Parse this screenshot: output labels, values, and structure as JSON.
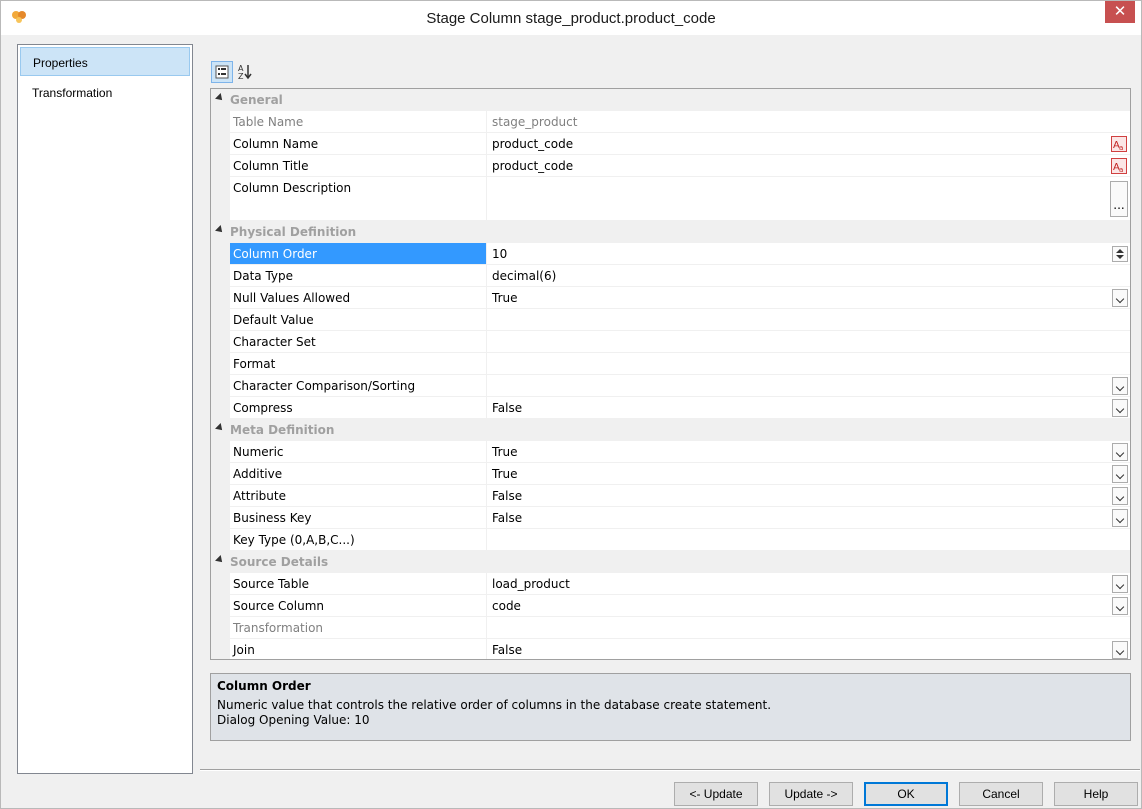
{
  "window": {
    "title": "Stage Column stage_product.product_code",
    "close_label": "✕"
  },
  "nav": {
    "items": [
      {
        "label": "Properties",
        "selected": true
      },
      {
        "label": "Transformation",
        "selected": false
      }
    ]
  },
  "toolbar": {
    "categorized_icon": "categorized-icon",
    "alphabetical_icon": "sort-az-icon"
  },
  "grid": {
    "categories": {
      "general": "General",
      "physical": "Physical Definition",
      "meta": "Meta Definition",
      "source": "Source Details"
    },
    "rows": {
      "table_name": {
        "name": "Table Name",
        "value": "stage_product"
      },
      "column_name": {
        "name": "Column Name",
        "value": "product_code"
      },
      "column_title": {
        "name": "Column Title",
        "value": "product_code"
      },
      "column_description": {
        "name": "Column Description",
        "value": "",
        "button": "..."
      },
      "column_order": {
        "name": "Column Order",
        "value": "10"
      },
      "data_type": {
        "name": "Data Type",
        "value": "decimal(6)"
      },
      "null_values": {
        "name": "Null Values Allowed",
        "value": "True"
      },
      "default_value": {
        "name": "Default Value",
        "value": ""
      },
      "character_set": {
        "name": "Character Set",
        "value": ""
      },
      "format": {
        "name": "Format",
        "value": ""
      },
      "char_comparison": {
        "name": "Character Comparison/Sorting",
        "value": ""
      },
      "compress": {
        "name": "Compress",
        "value": "False"
      },
      "numeric": {
        "name": "Numeric",
        "value": "True"
      },
      "additive": {
        "name": "Additive",
        "value": "True"
      },
      "attribute": {
        "name": "Attribute",
        "value": "False"
      },
      "business_key": {
        "name": "Business Key",
        "value": "False"
      },
      "key_type": {
        "name": "Key Type (0,A,B,C...)",
        "value": ""
      },
      "source_table": {
        "name": "Source Table",
        "value": "load_product"
      },
      "source_column": {
        "name": "Source Column",
        "value": "code"
      },
      "transformation": {
        "name": "Transformation",
        "value": ""
      },
      "join": {
        "name": "Join",
        "value": "False"
      }
    }
  },
  "description": {
    "title": "Column Order",
    "text": "Numeric value that controls the relative order of columns in the database create statement.",
    "opening_value": "Dialog Opening Value: 10"
  },
  "buttons": {
    "update_back": "<- Update",
    "update_forward": "Update ->",
    "ok": "OK",
    "cancel": "Cancel",
    "help": "Help"
  },
  "colors": {
    "selected_row": "#3399ff",
    "nav_selected": "#cce4f7",
    "close_button": "#c75050",
    "description_bg": "#dfe3e8"
  }
}
